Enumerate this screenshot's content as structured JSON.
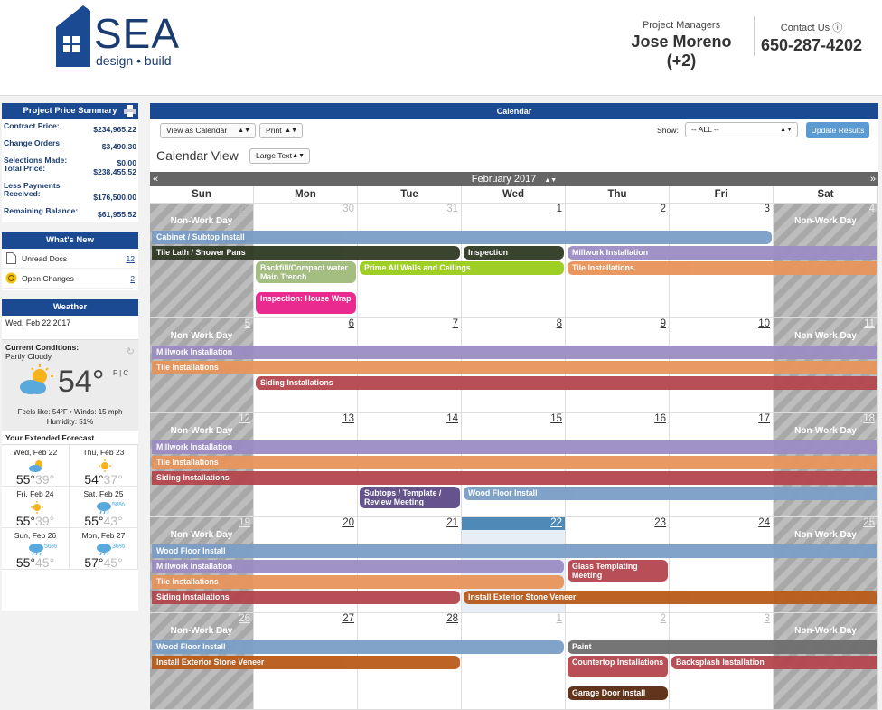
{
  "header": {
    "logo_name": "SEA",
    "logo_tagline": "design • build",
    "pm_label": "Project Managers",
    "pm_name": "Jose Moreno (+2)",
    "contact_label": "Contact Us ⓘ",
    "contact_phone": "650-287-4202"
  },
  "price_summary": {
    "title": "Project Price Summary",
    "rows": [
      {
        "label": "Contract Price:",
        "value": "$234,965.22"
      },
      {
        "label": "Change Orders:",
        "value": "$3,490.30"
      },
      {
        "label": "Selections Made:\nTotal Price:",
        "value": "$0.00\n$238,455.52"
      },
      {
        "label": "Less Payments\nReceived:",
        "value": "$176,500.00"
      },
      {
        "label": "Remaining Balance:",
        "value": "$61,955.52"
      }
    ]
  },
  "whats_new": {
    "title": "What's New",
    "items": [
      {
        "label": "Unread Docs",
        "count": "12"
      },
      {
        "label": "Open Changes",
        "count": "2"
      }
    ]
  },
  "weather": {
    "title": "Weather",
    "date": "Wed, Feb 22 2017",
    "conditions_label": "Current Conditions:",
    "conditions": "Partly Cloudy",
    "temp": "54°",
    "unit_toggle": "F | C",
    "feels": "Feels like: 54°F • Winds: 15 mph",
    "humidity": "Humidity: 51%",
    "forecast_title": "Your Extended Forecast",
    "forecast": [
      {
        "day": "Wed, Feb 22",
        "icon": "partly-cloudy-icon",
        "hi": "55°",
        "lo": "39°",
        "pct": ""
      },
      {
        "day": "Thu, Feb 23",
        "icon": "sun-icon",
        "hi": "54°",
        "lo": "37°",
        "pct": ""
      },
      {
        "day": "Fri, Feb 24",
        "icon": "sun-icon",
        "hi": "55°",
        "lo": "39°",
        "pct": ""
      },
      {
        "day": "Sat, Feb 25",
        "icon": "rain-icon",
        "hi": "55°",
        "lo": "43°",
        "pct": "58%"
      },
      {
        "day": "Sun, Feb 26",
        "icon": "rain-icon",
        "hi": "55°",
        "lo": "45°",
        "pct": "56%"
      },
      {
        "day": "Mon, Feb 27",
        "icon": "rain-icon",
        "hi": "57°",
        "lo": "45°",
        "pct": "36%"
      }
    ]
  },
  "calendar": {
    "title": "Calendar",
    "view_select": "View as Calendar",
    "print_select": "Print",
    "show_label": "Show:",
    "show_select": "-- ALL --",
    "update_button": "Update Results",
    "view_title": "Calendar View",
    "text_size_select": "Large Text",
    "month_label": "February 2017",
    "prev_label": "«",
    "next_label": "»",
    "day_names": [
      "Sun",
      "Mon",
      "Tue",
      "Wed",
      "Thu",
      "Fri",
      "Sat"
    ],
    "non_work_label": "Non-Work Day",
    "weeks": [
      {
        "days": [
          "29",
          "30",
          "31",
          "1",
          "2",
          "3",
          "4"
        ],
        "out": [
          true,
          true,
          true,
          false,
          false,
          false,
          false
        ]
      },
      {
        "days": [
          "5",
          "6",
          "7",
          "8",
          "9",
          "10",
          "11"
        ],
        "out": [
          false,
          false,
          false,
          false,
          false,
          false,
          false
        ]
      },
      {
        "days": [
          "12",
          "13",
          "14",
          "15",
          "16",
          "17",
          "18"
        ],
        "out": [
          false,
          false,
          false,
          false,
          false,
          false,
          false
        ]
      },
      {
        "days": [
          "19",
          "20",
          "21",
          "22",
          "23",
          "24",
          "25"
        ],
        "out": [
          false,
          false,
          false,
          false,
          false,
          false,
          false
        ]
      },
      {
        "days": [
          "26",
          "27",
          "28",
          "1",
          "2",
          "3",
          "4"
        ],
        "out": [
          false,
          false,
          false,
          true,
          true,
          true,
          true
        ]
      }
    ],
    "today": "22",
    "events": [
      {
        "week": 0,
        "start": 0,
        "span": 6,
        "lane": 0,
        "label": "Cabinet / Subtop Install",
        "color": "#7a9ec6"
      },
      {
        "week": 0,
        "start": 0,
        "span": 3,
        "lane": 1,
        "label": "Tile Lath / Shower Pans",
        "color": "#2f3a24"
      },
      {
        "week": 0,
        "start": 3,
        "span": 1,
        "lane": 1,
        "label": "Inspection",
        "color": "#2f3a24"
      },
      {
        "week": 0,
        "start": 4,
        "span": 3,
        "lane": 1,
        "label": "Millwork Installation",
        "color": "#9b8cc4"
      },
      {
        "week": 0,
        "start": 1,
        "span": 1,
        "lane": 2,
        "label": "Backfill/Compact water Main Trench",
        "color": "#9fbb7a",
        "two": true
      },
      {
        "week": 0,
        "start": 2,
        "span": 2,
        "lane": 2,
        "label": "Prime All Walls and Ceilings",
        "color": "#9acd1a"
      },
      {
        "week": 0,
        "start": 4,
        "span": 3,
        "lane": 2,
        "label": "Tile Installations",
        "color": "#e8935a"
      },
      {
        "week": 0,
        "start": 1,
        "span": 1,
        "lane": 4,
        "label": "Inspection: House Wrap",
        "color": "#ea1f8b",
        "two": true
      },
      {
        "week": 1,
        "start": 0,
        "span": 7,
        "lane": 0,
        "label": "Millwork Installation",
        "color": "#9b8cc4"
      },
      {
        "week": 1,
        "start": 0,
        "span": 7,
        "lane": 1,
        "label": "Tile Installations",
        "color": "#e8935a"
      },
      {
        "week": 1,
        "start": 1,
        "span": 6,
        "lane": 2,
        "label": "Siding Installations",
        "color": "#b5464d"
      },
      {
        "week": 2,
        "start": 0,
        "span": 7,
        "lane": 0,
        "label": "Millwork Installation",
        "color": "#9b8cc4"
      },
      {
        "week": 2,
        "start": 0,
        "span": 7,
        "lane": 1,
        "label": "Tile Installations",
        "color": "#e8935a"
      },
      {
        "week": 2,
        "start": 0,
        "span": 7,
        "lane": 2,
        "label": "Siding Installations",
        "color": "#b5464d"
      },
      {
        "week": 2,
        "start": 2,
        "span": 1,
        "lane": 3,
        "label": "Subtops / Template / Review Meeting",
        "color": "#5c4a86",
        "two": true
      },
      {
        "week": 2,
        "start": 3,
        "span": 4,
        "lane": 3,
        "label": "Wood Floor Install",
        "color": "#7a9ec6"
      },
      {
        "week": 3,
        "start": 0,
        "span": 7,
        "lane": 0,
        "label": "Wood Floor Install",
        "color": "#7a9ec6"
      },
      {
        "week": 3,
        "start": 0,
        "span": 4,
        "lane": 1,
        "label": "Millwork Installation",
        "color": "#9b8cc4"
      },
      {
        "week": 3,
        "start": 4,
        "span": 1,
        "lane": 1,
        "label": "Glass Templating Meeting",
        "color": "#b5464d",
        "two": true
      },
      {
        "week": 3,
        "start": 0,
        "span": 4,
        "lane": 2,
        "label": "Tile Installations",
        "color": "#e8935a"
      },
      {
        "week": 3,
        "start": 0,
        "span": 3,
        "lane": 3,
        "label": "Siding Installations",
        "color": "#b5464d"
      },
      {
        "week": 3,
        "start": 3,
        "span": 4,
        "lane": 3,
        "label": "Install Exterior Stone Veneer",
        "color": "#b85b1a"
      },
      {
        "week": 4,
        "start": 0,
        "span": 4,
        "lane": 0,
        "label": "Wood Floor Install",
        "color": "#7a9ec6"
      },
      {
        "week": 4,
        "start": 4,
        "span": 3,
        "lane": 0,
        "label": "Paint",
        "color": "#6e6e6e"
      },
      {
        "week": 4,
        "start": 0,
        "span": 3,
        "lane": 1,
        "label": "Install Exterior Stone Veneer",
        "color": "#b85b1a"
      },
      {
        "week": 4,
        "start": 4,
        "span": 1,
        "lane": 1,
        "label": "Countertop Installations",
        "color": "#b5464d",
        "two": true
      },
      {
        "week": 4,
        "start": 5,
        "span": 2,
        "lane": 1,
        "label": "Backsplash Installation",
        "color": "#b5464d"
      },
      {
        "week": 4,
        "start": 4,
        "span": 1,
        "lane": 3,
        "label": "Garage Door Install",
        "color": "#5a2a10"
      }
    ]
  }
}
